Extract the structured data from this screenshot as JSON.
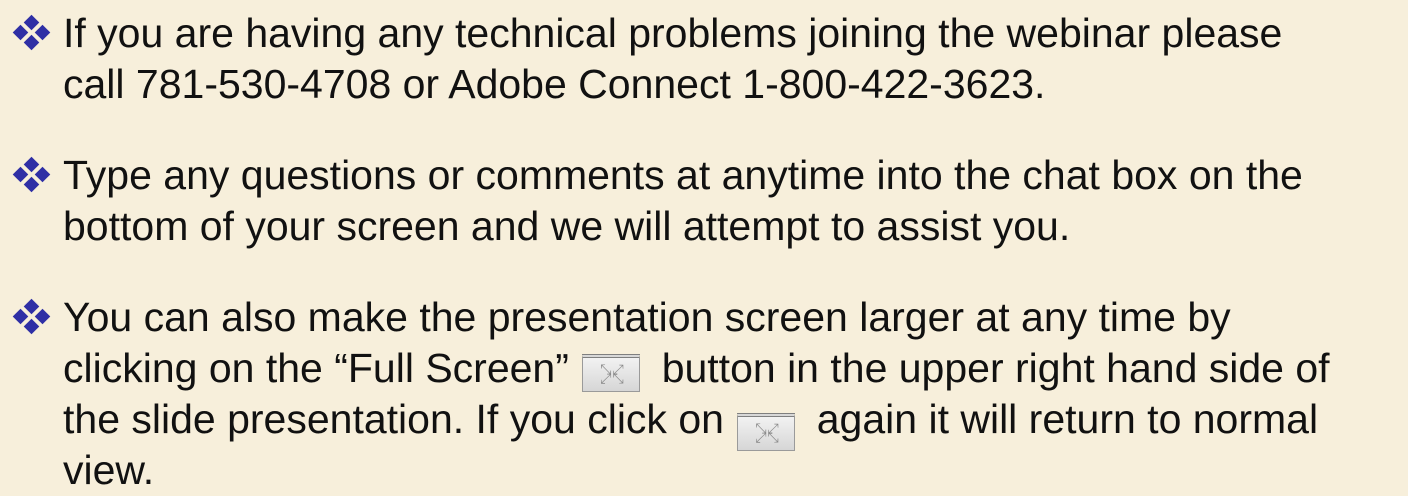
{
  "colors": {
    "background": "#f7efdb",
    "bullet": "#2f2fa5",
    "text": "#111111"
  },
  "bullets": [
    {
      "line1": "If you are having any technical problems joining the webinar please",
      "line2": "call 781-530-4708 or Adobe Connect 1-800-422-3623."
    },
    {
      "line1": "Type any questions or comments at anytime into the chat box on the",
      "line2": "bottom of your screen and we will attempt to assist you."
    },
    {
      "line1": "You can also make the presentation screen larger at any time by",
      "line2_before": "clicking on the “Full Screen”",
      "line2_after": "button in the upper right hand side of",
      "line3_before": "the slide presentation.  If you click on",
      "line3_after": "again it will return to normal",
      "line4": "view."
    }
  ],
  "icons": {
    "bullet_icon": "four-diamond-bullet",
    "full_screen_icon": "full-screen-button-icon"
  }
}
